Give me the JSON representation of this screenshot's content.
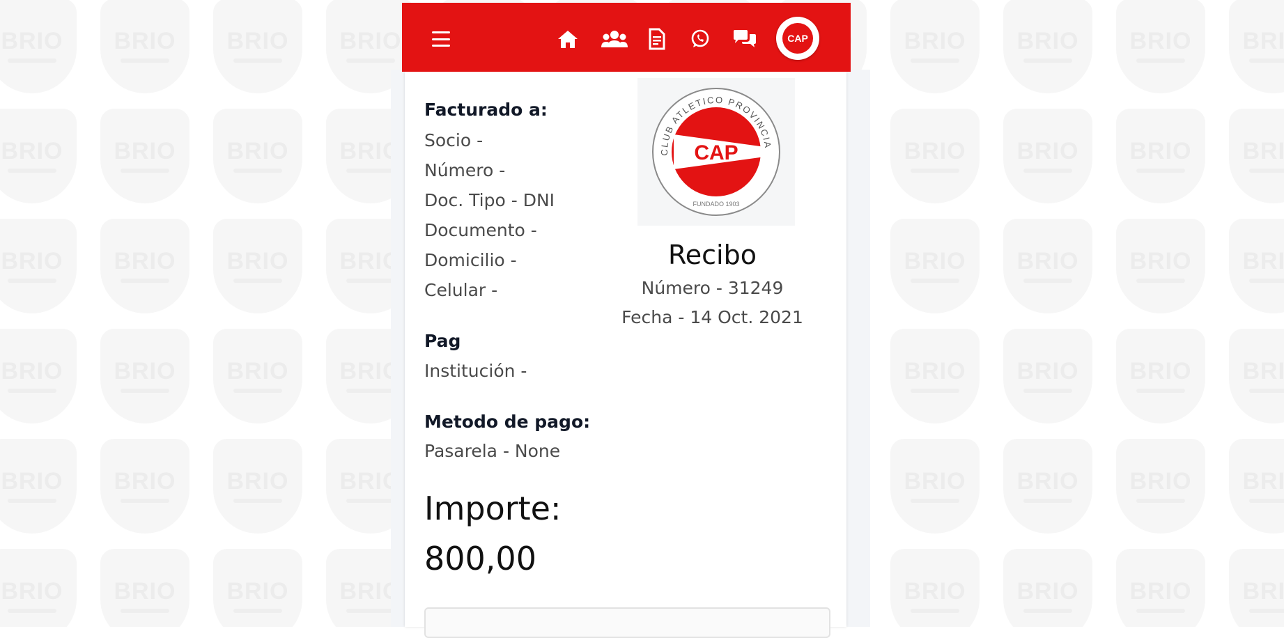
{
  "nav": {
    "icons": [
      "menu-icon",
      "home-icon",
      "users-icon",
      "document-icon",
      "whatsapp-icon",
      "chat-icon"
    ],
    "avatar_text": "CAP",
    "brand_color": "#e31313"
  },
  "watermark_text": "BRIO",
  "billing": {
    "heading": "Facturado a:",
    "lines": [
      "Socio -",
      "Número -",
      "Doc. Tipo - DNI",
      "Documento -",
      "Domicilio -",
      "Celular -"
    ]
  },
  "payment": {
    "heading": "Pag",
    "institution": "Institución -"
  },
  "method": {
    "heading": "Metodo de pago:",
    "gateway": "Pasarela - None"
  },
  "logo": {
    "ring_text": "CLUB ATLETICO PROVINCIAL",
    "initials": "CAP",
    "founded": "FUNDADO 1903"
  },
  "receipt": {
    "title": "Recibo",
    "number": "Número - 31249",
    "date": "Fecha - 14 Oct. 2021"
  },
  "amount": {
    "label": "Importe:",
    "value": "800,00"
  }
}
